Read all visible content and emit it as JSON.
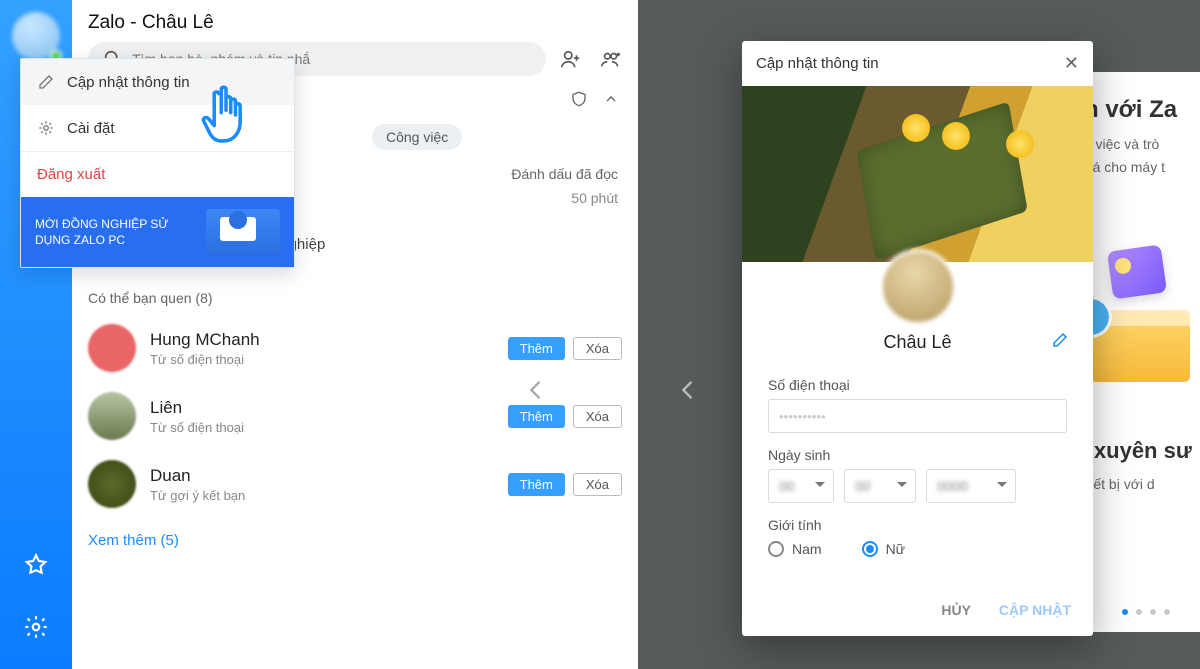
{
  "header": {
    "title": "Zalo - Châu Lê",
    "search_placeholder": "Tìm bạn bè, nhóm và tin nhắ"
  },
  "dropdown": {
    "update": "Cập nhật thông tin",
    "settings": "Cài đặt",
    "logout": "Đăng xuất",
    "promo": "MỜI ĐỒNG NGHIỆP SỬ DỤNG ZALO PC"
  },
  "filters": {
    "work": "Công việc",
    "mark_read": "Đánh dấu đã đọc",
    "time": "50 phút"
  },
  "find_more": "Tìm thêm bạn đồng nghiệp",
  "maybe_know": {
    "label": "Có thể bạn quen (8)",
    "count": 8
  },
  "people": [
    {
      "name": "Hung MChanh",
      "sub": "Từ số điện thoại"
    },
    {
      "name": "Liên",
      "sub": "Từ số điện thoại"
    },
    {
      "name": "Duan",
      "sub": "Từ gợi ý kết bạn"
    }
  ],
  "btn_add": "Thêm",
  "btn_del": "Xóa",
  "see_more": "Xem thêm (5)",
  "right_bg": {
    "headline": "đến với Za",
    "sub1": "ợ làm việc và trò",
    "sub2": "ưu hoá cho máy t",
    "headline2": "ệm xuyên sư",
    "sub3": "nọi thiết bị với d"
  },
  "modal": {
    "title": "Cập nhật thông tin",
    "name": "Châu Lê",
    "phone_label": "Số điện thoại",
    "dob_label": "Ngày sinh",
    "gender_label": "Giới tính",
    "male": "Nam",
    "female": "Nữ",
    "cancel": "HỦY",
    "save": "CẬP NHẬT"
  }
}
